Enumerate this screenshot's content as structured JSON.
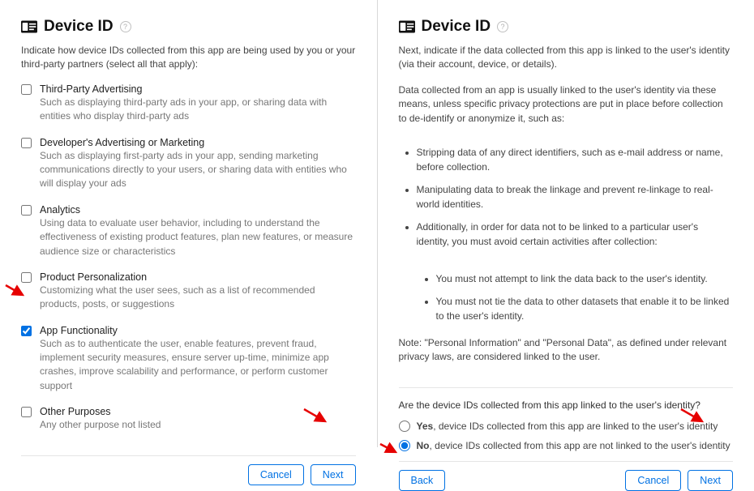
{
  "left": {
    "title": "Device ID",
    "intro": "Indicate how device IDs collected from this app are being used by you or your third-party partners (select all that apply):",
    "options": [
      {
        "label": "Third-Party Advertising",
        "desc": "Such as displaying third-party ads in your app, or sharing data with entities who display third-party ads",
        "checked": false
      },
      {
        "label": "Developer's Advertising or Marketing",
        "desc": "Such as displaying first-party ads in your app, sending marketing communications directly to your users, or sharing data with entities who will display your ads",
        "checked": false
      },
      {
        "label": "Analytics",
        "desc": "Using data to evaluate user behavior, including to understand the effectiveness of existing product features, plan new features, or measure audience size or characteristics",
        "checked": false
      },
      {
        "label": "Product Personalization",
        "desc": "Customizing what the user sees, such as a list of recommended products, posts, or suggestions",
        "checked": false
      },
      {
        "label": "App Functionality",
        "desc": "Such as to authenticate the user, enable features, prevent fraud, implement security measures, ensure server up-time, minimize app crashes, improve scalability and performance, or perform customer support",
        "checked": true
      },
      {
        "label": "Other Purposes",
        "desc": "Any other purpose not listed",
        "checked": false
      }
    ],
    "cancel": "Cancel",
    "next": "Next"
  },
  "right": {
    "title": "Device ID",
    "intro": "Next, indicate if the data collected from this app is linked to the user's identity (via their account, device, or details).",
    "explain": "Data collected from an app is usually linked to the user's identity via these means, unless specific privacy protections are put in place before collection to de-identify or anonymize it, such as:",
    "bullets": [
      "Stripping data of any direct identifiers, such as e-mail address or name, before collection.",
      "Manipulating data to break the linkage and prevent re-linkage to real-world identities.",
      "Additionally, in order for data not to be linked to a particular user's identity, you must avoid certain activities after collection:"
    ],
    "sub_bullets": [
      "You must not attempt to link the data back to the user's identity.",
      "You must not tie the data to other datasets that enable it to be linked to the user's identity."
    ],
    "note": "Note: \"Personal Information\" and \"Personal Data\", as defined under relevant privacy laws, are considered linked to the user.",
    "question": "Are the device IDs collected from this app linked to the user's identity?",
    "yes_label_prefix": "Yes",
    "yes_label_rest": ", device IDs collected from this app are linked to the user's identity",
    "no_label_prefix": "No",
    "no_label_rest": ", device IDs collected from this app are not linked to the user's identity",
    "back": "Back",
    "cancel": "Cancel",
    "next": "Next"
  }
}
